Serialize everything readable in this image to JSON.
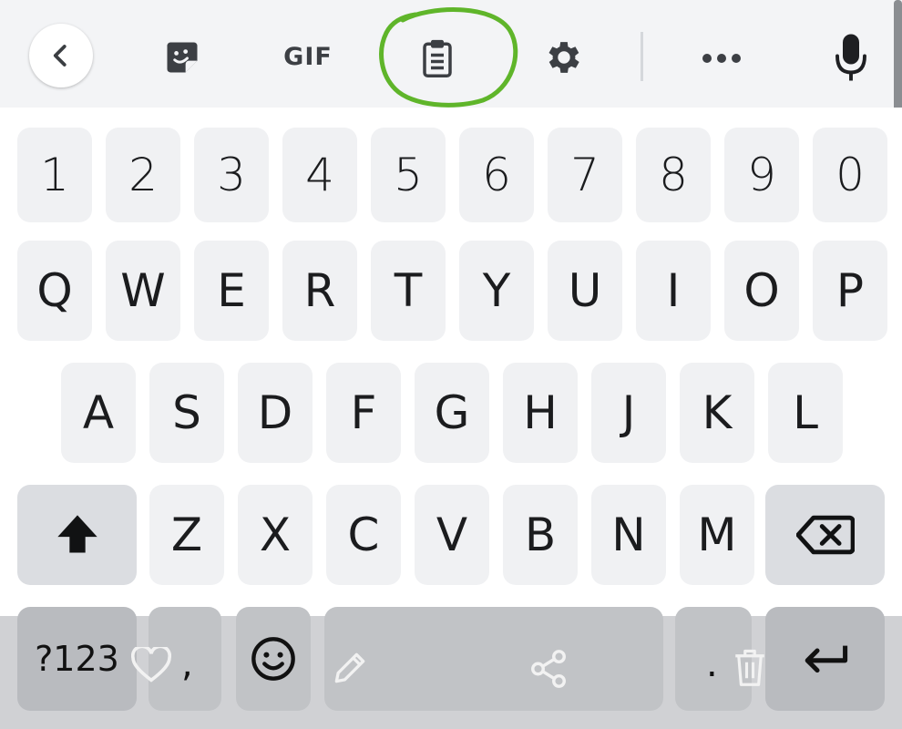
{
  "toolbar": {
    "back": "chevron-left-icon",
    "sticker": "sticker-icon",
    "gif_label": "GIF",
    "clipboard": "clipboard-icon",
    "settings": "gear-icon",
    "more": "more-horizontal-icon",
    "voice": "microphone-icon",
    "highlight_color": "#5fb52a"
  },
  "keyboard": {
    "number_row": [
      "1",
      "2",
      "3",
      "4",
      "5",
      "6",
      "7",
      "8",
      "9",
      "0"
    ],
    "row1": [
      "Q",
      "W",
      "E",
      "R",
      "T",
      "Y",
      "U",
      "I",
      "O",
      "P"
    ],
    "row2": [
      "A",
      "S",
      "D",
      "F",
      "G",
      "H",
      "J",
      "K",
      "L"
    ],
    "row3": [
      "Z",
      "X",
      "C",
      "V",
      "B",
      "N",
      "M"
    ],
    "shift": "shift-icon",
    "backspace": "backspace-icon",
    "symbols_label": "?123",
    "comma_label": ",",
    "period_label": ".",
    "emoji": "emoji-icon",
    "enter": "enter-icon"
  },
  "overlay": {
    "like": "heart-icon",
    "edit": "pencil-icon",
    "share": "share-icon",
    "delete": "trash-icon"
  }
}
